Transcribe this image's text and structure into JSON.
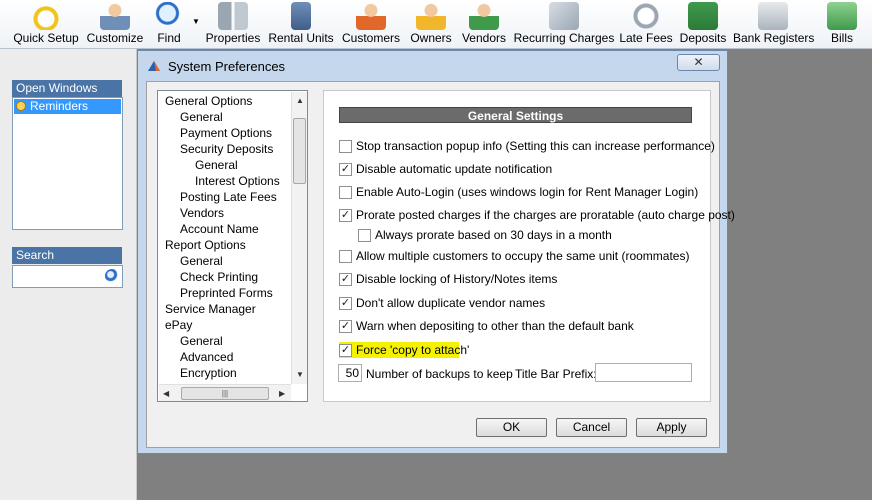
{
  "toolbar": {
    "items": [
      {
        "label": "Quick Setup",
        "icon": "stopwatch-icon"
      },
      {
        "label": "Customize",
        "icon": "user-settings-icon"
      },
      {
        "label": "Find",
        "icon": "magnifier-icon"
      },
      {
        "label": "Properties",
        "icon": "buildings-icon"
      },
      {
        "label": "Rental Units",
        "icon": "door-icon"
      },
      {
        "label": "Customers",
        "icon": "customer-icon"
      },
      {
        "label": "Owners",
        "icon": "owner-icon"
      },
      {
        "label": "Vendors",
        "icon": "vendor-icon"
      },
      {
        "label": "Recurring Charges",
        "icon": "recurring-charges-icon"
      },
      {
        "label": "Late Fees",
        "icon": "late-fees-icon"
      },
      {
        "label": "Deposits",
        "icon": "deposit-icon"
      },
      {
        "label": "Bank Registers",
        "icon": "bank-register-icon"
      },
      {
        "label": "Bills",
        "icon": "bills-icon"
      }
    ]
  },
  "left_panel": {
    "open_windows_title": "Open Windows",
    "open_windows_items": [
      {
        "label": "Reminders",
        "icon": "clock-icon"
      }
    ],
    "search_title": "Search",
    "search_value": ""
  },
  "dialog": {
    "title": "System Preferences",
    "close_label": "✕",
    "tree": [
      {
        "label": "General Options",
        "level": 0
      },
      {
        "label": "General",
        "level": 1
      },
      {
        "label": "Payment Options",
        "level": 1
      },
      {
        "label": "Security Deposits",
        "level": 1
      },
      {
        "label": "General",
        "level": 2
      },
      {
        "label": "Interest Options",
        "level": 2
      },
      {
        "label": "Posting Late Fees",
        "level": 1
      },
      {
        "label": "Vendors",
        "level": 1
      },
      {
        "label": "Account Name",
        "level": 1
      },
      {
        "label": "Report Options",
        "level": 0
      },
      {
        "label": "General",
        "level": 1
      },
      {
        "label": "Check Printing",
        "level": 1
      },
      {
        "label": "Preprinted Forms",
        "level": 1
      },
      {
        "label": "Service Manager",
        "level": 0
      },
      {
        "label": "ePay",
        "level": 0
      },
      {
        "label": "General",
        "level": 1
      },
      {
        "label": "Advanced",
        "level": 1
      },
      {
        "label": "Encryption",
        "level": 1
      }
    ],
    "section_title": "General Settings",
    "options": [
      {
        "label": "Stop transaction popup info (Setting this can increase performance)",
        "checked": false
      },
      {
        "label": "Disable automatic update notification",
        "checked": true
      },
      {
        "label": "Enable Auto-Login (uses windows login for Rent Manager Login)",
        "checked": false
      },
      {
        "label": "Prorate posted charges if the charges are proratable (auto charge post)",
        "checked": true
      },
      {
        "label": "Always prorate based on 30 days in a month",
        "checked": false
      },
      {
        "label": "Allow multiple customers to occupy the same unit (roommates)",
        "checked": false
      },
      {
        "label": "Disable locking of History/Notes items",
        "checked": true
      },
      {
        "label": "Don't allow duplicate vendor names",
        "checked": true
      },
      {
        "label": "Warn when depositing to other than the default bank",
        "checked": true
      },
      {
        "label": "Force 'copy to attach'",
        "checked": true,
        "highlight": "#f4f200"
      }
    ],
    "backups_value": "50",
    "backups_label": "Number of backups to keep",
    "title_prefix_label": "Title Bar Prefix:",
    "title_prefix_value": "",
    "buttons": {
      "ok": "OK",
      "cancel": "Cancel",
      "apply": "Apply"
    }
  },
  "colors": {
    "panel_header": "#4a73a6",
    "selection": "#3399ff",
    "highlight": "#f4f200"
  }
}
